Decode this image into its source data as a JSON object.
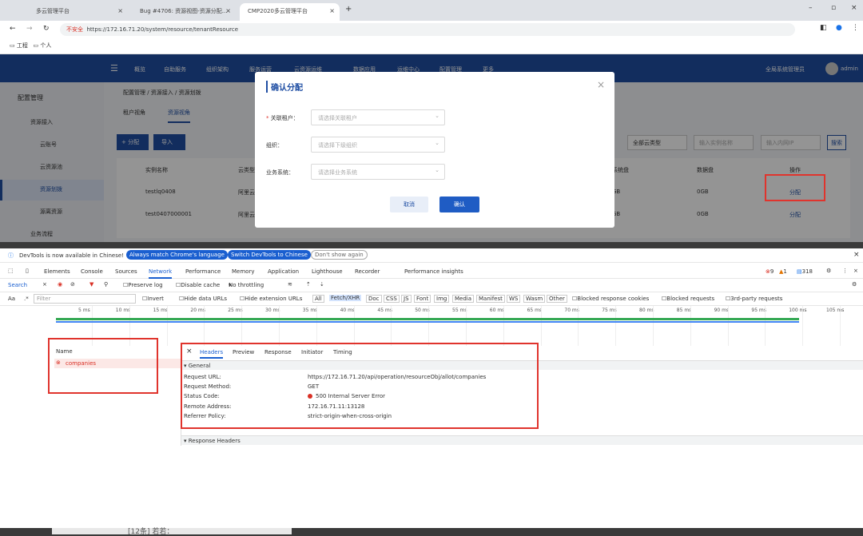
{
  "browser": {
    "tabs": [
      "多云管理平台",
      "Bug #4706: 资源视图-资源分配...",
      "CMP2020多云管理平台"
    ],
    "url": "https://172.16.71.20/system/resource/tenantResource",
    "url_badge": "不安全",
    "bookmarks": [
      "工程",
      "个人"
    ]
  },
  "app": {
    "nav": [
      "概览",
      "自助服务",
      "组织架构",
      "服务运营",
      "云资源运维",
      "数据应用",
      "运维中心",
      "配置管理",
      "更多"
    ],
    "user_menu": "全局系统管理员",
    "user": "admin",
    "sidebar_title": "配置管理",
    "sidebar": [
      "资源接入",
      "云账号",
      "云资源池",
      "资源划拨",
      "源离资源",
      "业务流程"
    ],
    "breadcrumb": "配置管理 / 资源接入 / 资源划拨",
    "view_tabs": [
      "租户视角",
      "资源视角"
    ],
    "buttons": {
      "allocate": "+ 分配",
      "import": "导入",
      "search": "搜索"
    },
    "filters": {
      "type": "全部云类型",
      "name": "输入实例名称",
      "ip": "输入内网IP"
    },
    "table_headers": [
      "实例名称",
      "云类型",
      "系统盘",
      "数据盘",
      "操作"
    ],
    "rows": [
      {
        "name": "testlq0408",
        "cloud": "阿里云",
        "sys": "GB",
        "data": "0GB",
        "op": "分配"
      },
      {
        "name": "test0407000001",
        "cloud": "阿里云",
        "sys": "GB",
        "data": "0GB",
        "op": "分配"
      }
    ]
  },
  "dialog": {
    "title": "确认分配",
    "fields": [
      {
        "label": "关联租户：",
        "placeholder": "请选择关联租户"
      },
      {
        "label": "组织：",
        "placeholder": "请选择下级组织"
      },
      {
        "label": "业务系统：",
        "placeholder": "请选择业务系统"
      }
    ],
    "cancel": "取消",
    "confirm": "确认"
  },
  "devtools": {
    "banner": "DevTools is now available in Chinese!",
    "banner_buttons": [
      "Always match Chrome's language",
      "Switch DevTools to Chinese",
      "Don't show again"
    ],
    "tabs": [
      "Elements",
      "Console",
      "Sources",
      "Network",
      "Performance",
      "Memory",
      "Application",
      "Lighthouse",
      "Recorder",
      "Performance insights"
    ],
    "active_tab": "Network",
    "counts": {
      "errors": "9",
      "warnings": "1",
      "info": "318"
    },
    "toolbar": {
      "search": "Search",
      "preserve": "Preserve log",
      "cache": "Disable cache",
      "throttle": "No throttling"
    },
    "filter_placeholder": "Filter",
    "filter_options": [
      "Invert",
      "Hide data URLs",
      "Hide extension URLs"
    ],
    "type_filters": [
      "All",
      "Fetch/XHR",
      "Doc",
      "CSS",
      "JS",
      "Font",
      "Img",
      "Media",
      "Manifest",
      "WS",
      "Wasm",
      "Other"
    ],
    "extra_filters": [
      "Blocked response cookies",
      "Blocked requests",
      "3rd-party requests"
    ],
    "timeline_ticks": [
      "5 ms",
      "10 ms",
      "15 ms",
      "20 ms",
      "25 ms",
      "30 ms",
      "35 ms",
      "40 ms",
      "45 ms",
      "50 ms",
      "55 ms",
      "60 ms",
      "65 ms",
      "70 ms",
      "75 ms",
      "80 ms",
      "85 ms",
      "90 ms",
      "95 ms",
      "100 ms",
      "105 ms"
    ],
    "name_header": "Name",
    "request_name": "companies",
    "detail_tabs": [
      "Headers",
      "Preview",
      "Response",
      "Initiator",
      "Timing"
    ],
    "general_title": "General",
    "general": [
      {
        "k": "Request URL:",
        "v": "https://172.16.71.20/api/operation/resourceObj/allot/companies"
      },
      {
        "k": "Request Method:",
        "v": "GET"
      },
      {
        "k": "Status Code:",
        "v": "500 Internal Server Error"
      },
      {
        "k": "Remote Address:",
        "v": "172.16.71.11:13128"
      },
      {
        "k": "Referrer Policy:",
        "v": "strict-origin-when-cross-origin"
      }
    ],
    "response_headers_title": "Response Headers"
  },
  "taskbar_text": "[12条] 若若："
}
